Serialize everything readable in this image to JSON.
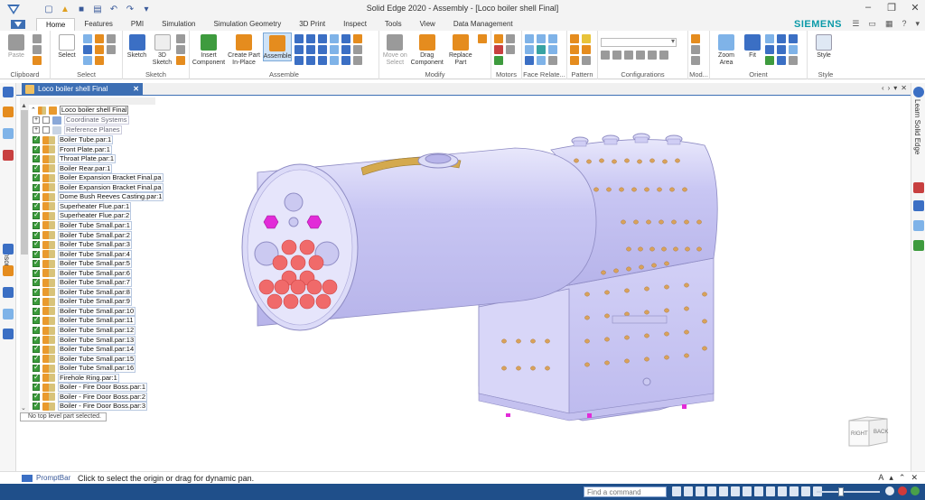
{
  "window": {
    "title": "Solid Edge 2020 - Assembly - [Loco boiler shell Final]"
  },
  "ribbon": {
    "brand": "SIEMENS",
    "tabs": [
      {
        "label": "Home",
        "active": true
      },
      {
        "label": "Features"
      },
      {
        "label": "PMI"
      },
      {
        "label": "Simulation"
      },
      {
        "label": "Simulation Geometry"
      },
      {
        "label": "3D Print"
      },
      {
        "label": "Inspect"
      },
      {
        "label": "Tools"
      },
      {
        "label": "View"
      },
      {
        "label": "Data Management"
      }
    ],
    "groups": {
      "clipboard": {
        "label": "Clipboard",
        "paste": "Paste"
      },
      "select": {
        "label": "Select",
        "select": "Select"
      },
      "sketch": {
        "label": "Sketch",
        "sketch": "Sketch",
        "sketch3d": "3D Sketch"
      },
      "assemble": {
        "label": "Assemble",
        "insert": "Insert Component",
        "create_part": "Create Part In-Place",
        "assemble": "Assemble"
      },
      "modify": {
        "label": "Modify",
        "move_on_select": "Move on Select",
        "drag": "Drag Component",
        "replace": "Replace Part"
      },
      "motors": {
        "label": "Motors"
      },
      "face_relate": {
        "label": "Face Relate..."
      },
      "pattern": {
        "label": "Pattern"
      },
      "configurations": {
        "label": "Configurations"
      },
      "mod": {
        "label": "Mod..."
      },
      "orient": {
        "label": "Orient",
        "zoom_area": "Zoom Area",
        "fit": "Fit"
      },
      "style": {
        "label": "Style",
        "style": "Style"
      }
    }
  },
  "document": {
    "tab_label": "Loco boiler shell Final",
    "close_glyph": "✕"
  },
  "left_strip": {
    "sensors_label": "Sensors"
  },
  "right_strip": {
    "learn_label": "Learn Solid Edge"
  },
  "tree": {
    "root": "Loco boiler shell Final",
    "coordinate_systems": "Coordinate Systems",
    "reference_planes": "Reference Planes",
    "items": [
      "Boiler Tube.par:1",
      "Front Plate.par:1",
      "Throat Plate.par:1",
      "Boiler Rear.par:1",
      "Boiler Expansion Bracket Final.pa",
      "Boiler Expansion Bracket Final.pa",
      "Dome Bush Reeves Casting.par:1",
      "Superheater Flue.par:1",
      "Superheater Flue.par:2",
      "Boiler Tube Small.par:1",
      "Boiler Tube Small.par:2",
      "Boiler Tube Small.par:3",
      "Boiler Tube Small.par:4",
      "Boiler Tube Small.par:5",
      "Boiler Tube Small.par:6",
      "Boiler Tube Small.par:7",
      "Boiler Tube Small.par:8",
      "Boiler Tube Small.par:9",
      "Boiler Tube Small.par:10",
      "Boiler Tube Small.par:11",
      "Boiler Tube Small.par:12",
      "Boiler Tube Small.par:13",
      "Boiler Tube Small.par:14",
      "Boiler Tube Small.par:15",
      "Boiler Tube Small.par:16",
      "Firehole Ring.par:1",
      "Boiler - Fire Door Boss.par:1",
      "Boiler - Fire Door Boss.par:2",
      "Boiler - Fire Door Boss.par:3"
    ],
    "status": "No top level part selected."
  },
  "viewcube": {
    "right": "RIGHT",
    "back": "BACK"
  },
  "promptbar": {
    "label": "PromptBar",
    "message": "Click to select the origin or drag for dynamic pan."
  },
  "statusbar": {
    "command_placeholder": "Find a command"
  },
  "colors": {
    "ribbon_accent": "#3d6fb4",
    "brand": "#0b9aa8",
    "model_body": "#c9c8f4",
    "tube_highlight": "#f06a6a",
    "flue_highlight": "#e22bd8",
    "rivet": "#d9a25a",
    "statusbar": "#1f4f8a"
  }
}
